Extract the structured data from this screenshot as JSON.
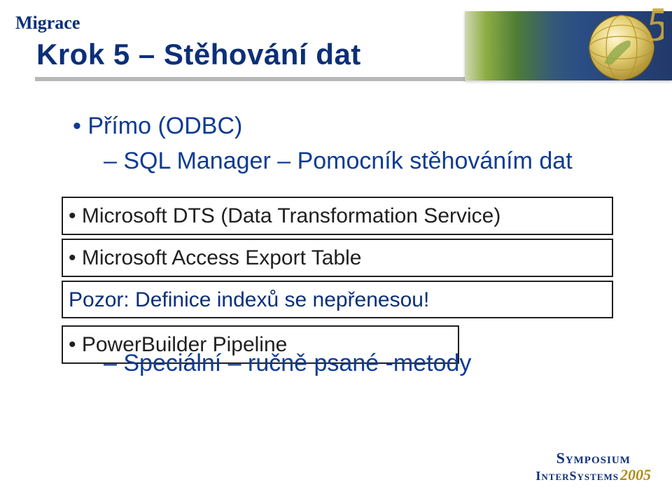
{
  "breadcrumb": "Migrace",
  "title": "Krok 5 – Stěhování dat",
  "bullets": {
    "b1": "Přímo (ODBC)",
    "sub1": "SQL Manager – Pomocník stěhováním dat"
  },
  "boxes": {
    "dts": "Microsoft DTS (Data Transformation Service)",
    "access": "Microsoft Access Export Table",
    "warn": "Pozor: Definice indexů se nepřenesou!",
    "pipeline": "PowerBuilder Pipeline"
  },
  "lower_sub": "Speciální – ručně psané -metody",
  "logo": {
    "line1": "Symposium",
    "line2": "InterSystems",
    "year": "2005"
  }
}
